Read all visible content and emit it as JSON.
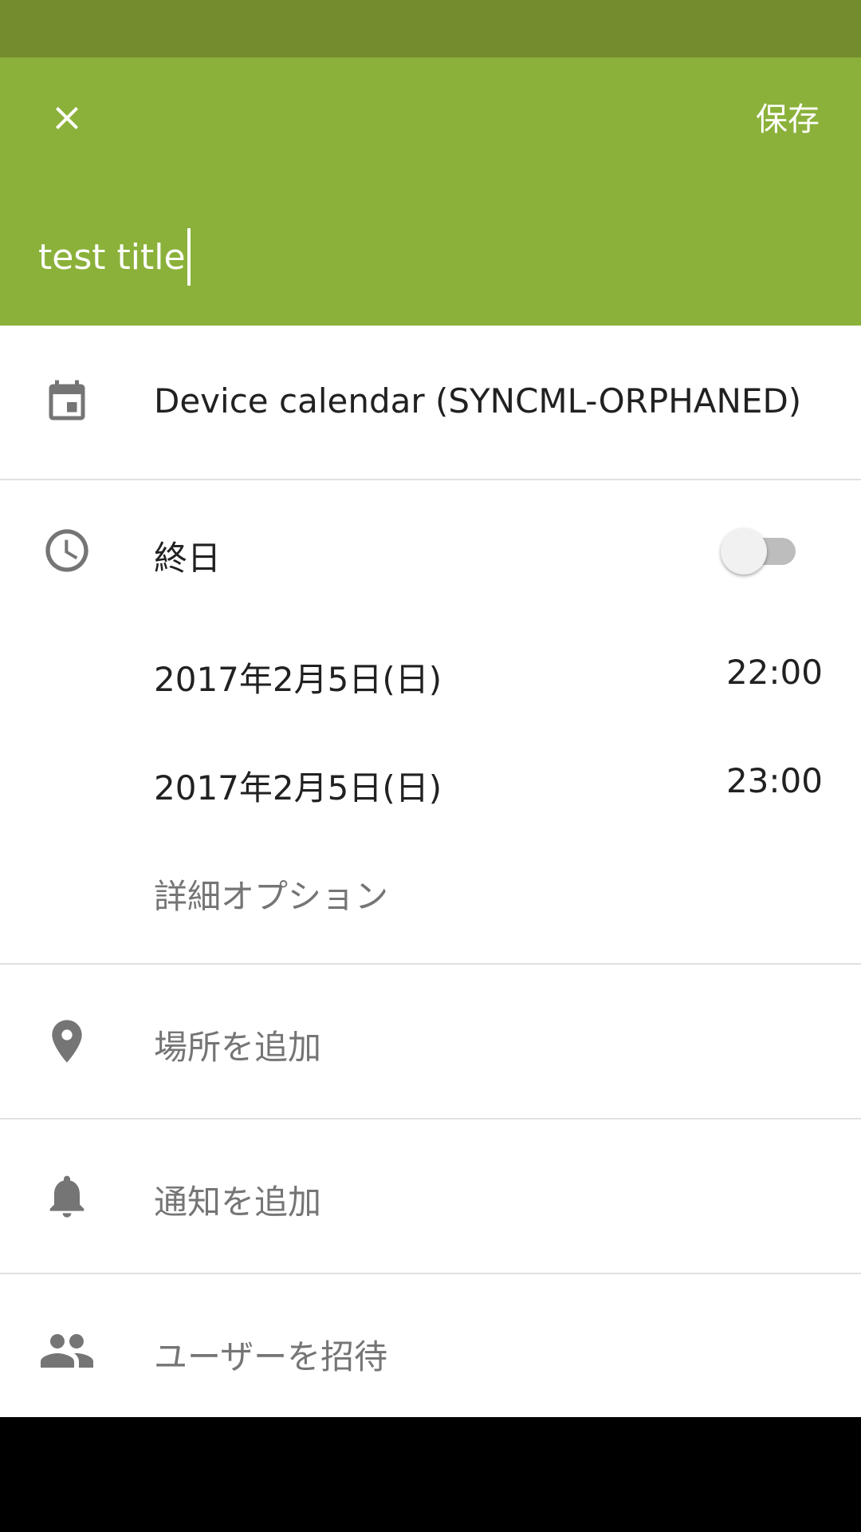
{
  "header": {
    "close_icon": "close-icon",
    "save_label": "保存",
    "title_value": "test title",
    "colors": {
      "status_bar": "#738c2e",
      "app_bar": "#8bb13a"
    }
  },
  "calendar": {
    "icon": "calendar-icon",
    "label": "Device calendar (SYNCML-ORPHANED)"
  },
  "all_day": {
    "icon": "clock-icon",
    "label": "終日",
    "enabled": false
  },
  "start": {
    "date": "2017年2月5日(日)",
    "time": "22:00"
  },
  "end": {
    "date": "2017年2月5日(日)",
    "time": "23:00"
  },
  "more_options": {
    "label": "詳細オプション"
  },
  "location": {
    "icon": "location-pin-icon",
    "label": "場所を追加"
  },
  "notification": {
    "icon": "bell-icon",
    "label": "通知を追加"
  },
  "invite": {
    "icon": "people-icon",
    "label": "ユーザーを招待"
  }
}
